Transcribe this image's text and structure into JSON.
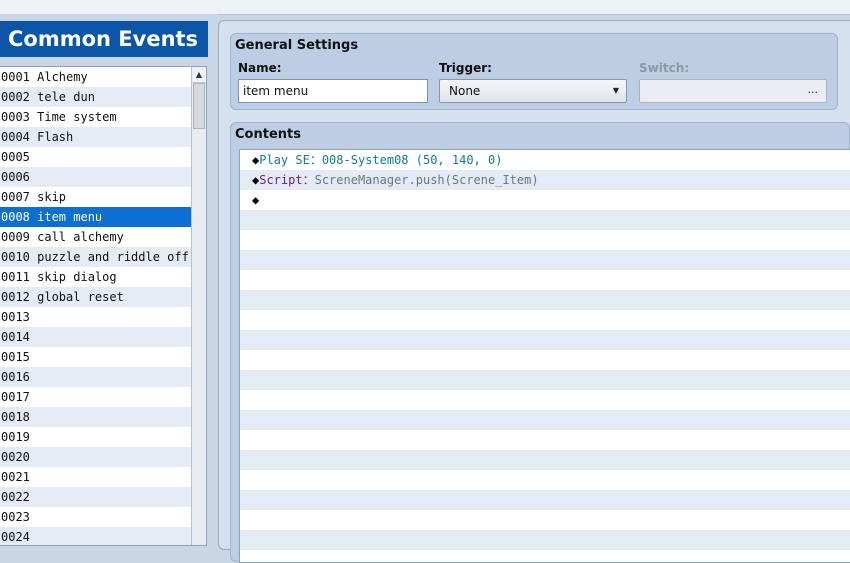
{
  "left_panel": {
    "title": "Common Events",
    "events": [
      {
        "label": "0001 Alchemy"
      },
      {
        "label": "0002 tele dun"
      },
      {
        "label": "0003 Time system"
      },
      {
        "label": "0004 Flash"
      },
      {
        "label": "0005"
      },
      {
        "label": "0006"
      },
      {
        "label": "0007 skip"
      },
      {
        "label": "0008 item menu",
        "selected": true
      },
      {
        "label": "0009 call alchemy"
      },
      {
        "label": "0010 puzzle and riddle off"
      },
      {
        "label": "0011 skip dialog"
      },
      {
        "label": "0012 global reset"
      },
      {
        "label": "0013"
      },
      {
        "label": "0014"
      },
      {
        "label": "0015"
      },
      {
        "label": "0016"
      },
      {
        "label": "0017"
      },
      {
        "label": "0018"
      },
      {
        "label": "0019"
      },
      {
        "label": "0020"
      },
      {
        "label": "0021"
      },
      {
        "label": "0022"
      },
      {
        "label": "0023"
      },
      {
        "label": "0024"
      }
    ]
  },
  "general_settings": {
    "title": "General Settings",
    "name_label": "Name:",
    "name_value": "item menu",
    "trigger_label": "Trigger:",
    "trigger_value": "None",
    "switch_label": "Switch:",
    "switch_button": "..."
  },
  "contents": {
    "title": "Contents",
    "commands": [
      {
        "marker": "◆",
        "keyword": "Play SE",
        "separator": "：",
        "detail": "008-System08 (50, 140, 0)",
        "keyword_color": "#0f7d86",
        "detail_color": "#0f7d86"
      },
      {
        "marker": "◆",
        "keyword": "Script",
        "separator": "：",
        "detail": "ScreneManager.push(Screne_Item)",
        "keyword_color": "#6e1c99",
        "detail_color": "#6c7680"
      },
      {
        "marker": "◆",
        "keyword": "",
        "separator": "",
        "detail": ""
      }
    ]
  },
  "colors": {
    "title_bar": "#0c55a8",
    "selection": "#0c6fd1",
    "alt_row": "#e5ebf3",
    "panel_bg": "#d5e0ee"
  }
}
